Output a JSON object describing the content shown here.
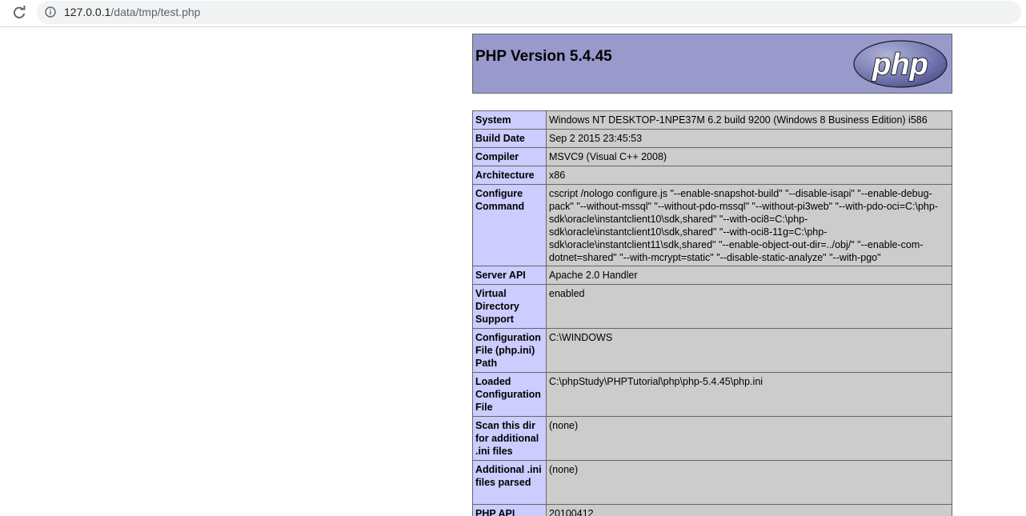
{
  "browser": {
    "url_host": "127.0.0.1",
    "url_path": "/data/tmp/test.php"
  },
  "phpinfo": {
    "title": "PHP Version 5.4.45",
    "logo_text": "php",
    "colors": {
      "header_bg": "#9999cc",
      "label_bg": "#ccccff",
      "value_bg": "#cccccc"
    },
    "rows": [
      {
        "label": "System",
        "value": "Windows NT DESKTOP-1NPE37M 6.2 build 9200 (Windows 8 Business Edition) i586"
      },
      {
        "label": "Build Date",
        "value": "Sep 2 2015 23:45:53"
      },
      {
        "label": "Compiler",
        "value": "MSVC9 (Visual C++ 2008)"
      },
      {
        "label": "Architecture",
        "value": "x86"
      },
      {
        "label": "Configure Command",
        "value": "cscript /nologo configure.js \"--enable-snapshot-build\" \"--disable-isapi\" \"--enable-debug-pack\" \"--without-mssql\" \"--without-pdo-mssql\" \"--without-pi3web\" \"--with-pdo-oci=C:\\php-sdk\\oracle\\instantclient10\\sdk,shared\" \"--with-oci8=C:\\php-sdk\\oracle\\instantclient10\\sdk,shared\" \"--with-oci8-11g=C:\\php-sdk\\oracle\\instantclient11\\sdk,shared\" \"--enable-object-out-dir=../obj/\" \"--enable-com-dotnet=shared\" \"--with-mcrypt=static\" \"--disable-static-analyze\" \"--with-pgo\""
      },
      {
        "label": "Server API",
        "value": "Apache 2.0 Handler"
      },
      {
        "label": "Virtual Directory Support",
        "value": "enabled"
      },
      {
        "label": "Configuration File (php.ini) Path",
        "value": "C:\\WINDOWS"
      },
      {
        "label": "Loaded Configuration File",
        "value": "C:\\phpStudy\\PHPTutorial\\php\\php-5.4.45\\php.ini"
      },
      {
        "label": "Scan this dir for additional .ini files",
        "value": "(none)"
      },
      {
        "label": "Additional .ini files parsed",
        "value": "(none)"
      },
      {
        "label": "PHP API",
        "value": "20100412"
      }
    ]
  }
}
